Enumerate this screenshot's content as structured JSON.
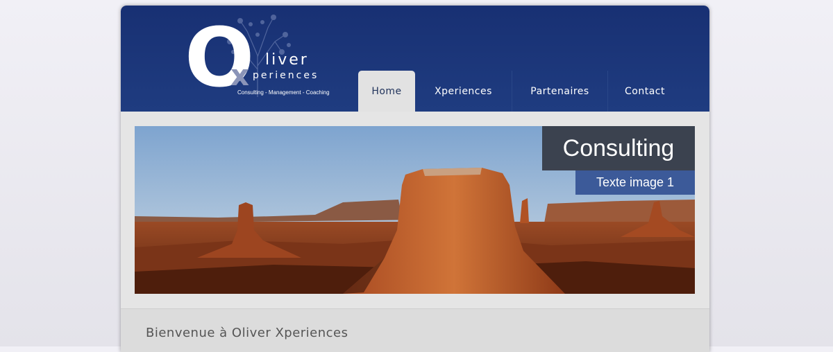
{
  "logo": {
    "letter_o": "O",
    "letter_x": "x",
    "word_line1": "liver",
    "word_line2": "periences",
    "tagline": "Consulting - Management - Coaching"
  },
  "nav": {
    "items": [
      {
        "label": "Home",
        "active": true
      },
      {
        "label": "Xperiences",
        "active": false
      },
      {
        "label": "Partenaires",
        "active": false
      },
      {
        "label": "Contact",
        "active": false
      }
    ]
  },
  "hero": {
    "caption_title": "Consulting",
    "caption_subtitle": "Texte image 1",
    "image_subject": "desert-buttes-landscape"
  },
  "content": {
    "heading": "Bienvenue à Oliver Xperiences"
  },
  "colors": {
    "header_blue": "#1f3c80",
    "caption_dark": "#373c48",
    "caption_blue": "#3c5a99",
    "page_grey": "#e5e5e5"
  }
}
